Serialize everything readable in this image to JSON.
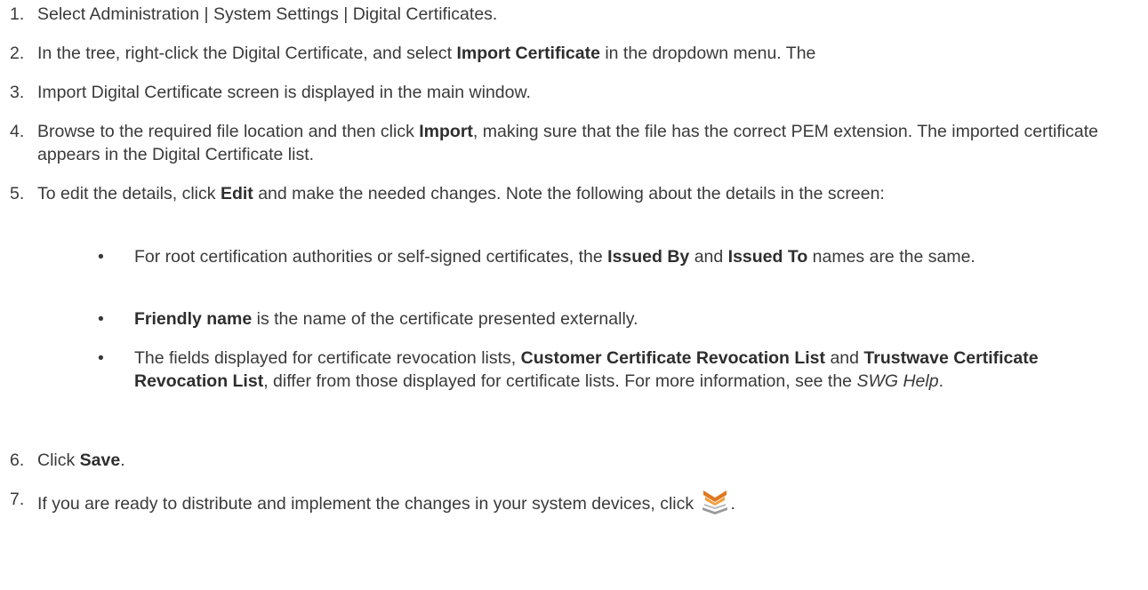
{
  "steps": [
    {
      "num": "1.",
      "parts": [
        {
          "t": "Select Administration | System Settings | Digital Certificates."
        }
      ]
    },
    {
      "num": "2.",
      "parts": [
        {
          "t": "In the tree, right-click the Digital Certificate, and select "
        },
        {
          "t": "Import Certificate",
          "b": true
        },
        {
          "t": " in the dropdown menu. The"
        }
      ]
    },
    {
      "num": "3.",
      "parts": [
        {
          "t": "Import Digital Certificate screen is displayed in the main window."
        }
      ]
    },
    {
      "num": "4.",
      "parts": [
        {
          "t": "Browse to the required file location and then click "
        },
        {
          "t": "Import",
          "b": true
        },
        {
          "t": ", making sure that the file has the correct PEM extension. The imported certificate appears in the Digital Certificate list."
        }
      ]
    },
    {
      "num": "5.",
      "parts": [
        {
          "t": "To edit the details, click "
        },
        {
          "t": "Edit",
          "b": true
        },
        {
          "t": " and make the needed changes. Note the following about the details in the screen:"
        }
      ]
    },
    {
      "num": "6.",
      "parts": [
        {
          "t": "Click "
        },
        {
          "t": "Save",
          "b": true
        },
        {
          "t": "."
        }
      ]
    },
    {
      "num": "7.",
      "parts": [
        {
          "t": "If you are ready to distribute and implement the changes in your system devices, click "
        },
        {
          "t": ".",
          "after_icon": true
        }
      ]
    }
  ],
  "bullets": [
    {
      "symbol": "•",
      "parts": [
        {
          "t": "For root certification authorities or self-signed certificates, the "
        },
        {
          "t": "Issued By",
          "b": true
        },
        {
          "t": " and "
        },
        {
          "t": "Issued To",
          "b": true
        },
        {
          "t": " names are the same."
        }
      ]
    },
    {
      "symbol": "•",
      "parts": [
        {
          "t": "Friendly name",
          "b": true
        },
        {
          "t": " is the name of the certificate presented externally."
        }
      ]
    },
    {
      "symbol": "•",
      "parts": [
        {
          "t": "The fields displayed for certificate revocation lists, "
        },
        {
          "t": "Customer Certificate Revocation List",
          "b": true
        },
        {
          "t": " and "
        },
        {
          "t": "Trustwave Certificate Revocation List",
          "b": true
        },
        {
          "t": ", differ from those displayed for certificate lists. For more information, see the "
        },
        {
          "t": "SWG Help",
          "i": true
        },
        {
          "t": "."
        }
      ]
    }
  ],
  "icons": {
    "commit": "commit-changes-icon"
  },
  "colors": {
    "text": "#3a3a3a",
    "icon_orange": "#e07820",
    "icon_gray": "#9a9a9a"
  }
}
